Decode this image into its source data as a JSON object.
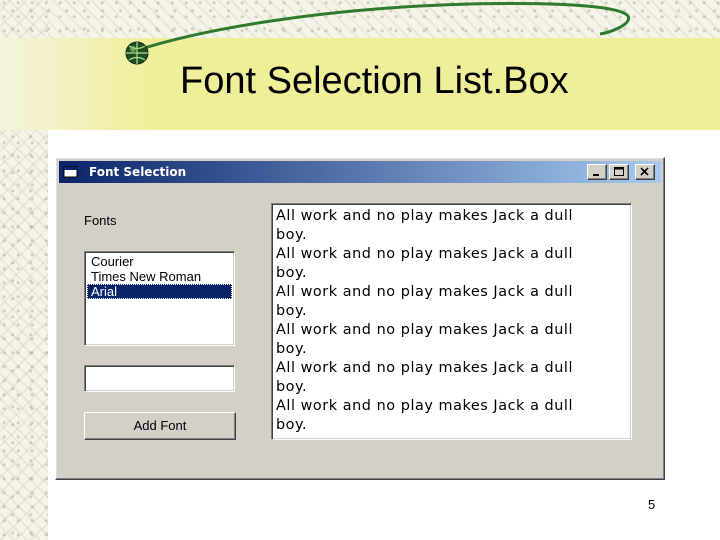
{
  "slide": {
    "title": "Font Selection List.Box",
    "page_number": "5"
  },
  "window": {
    "title": "Font Selection",
    "fonts_label": "Fonts",
    "font_list": [
      {
        "label": "Courier",
        "selected": false
      },
      {
        "label": "Times New Roman",
        "selected": false
      },
      {
        "label": "Arial",
        "selected": true
      }
    ],
    "font_input_value": "",
    "add_font_label": "Add Font",
    "text_lines": [
      "All work and no play makes Jack a dull",
      "boy.",
      "All work and no play makes Jack a dull",
      "boy.",
      "All work and no play makes Jack a dull",
      "boy.",
      "All work and no play makes Jack a dull",
      "boy.",
      "All work and no play makes Jack a dull",
      "boy.",
      "All work and no play makes Jack a dull",
      "boy."
    ]
  },
  "colors": {
    "title_band": "#efef9a",
    "window_titlebar_start": "#0a246a",
    "window_titlebar_end": "#a6caf0",
    "window_face": "#d4d0c8",
    "selection": "#0a246a",
    "deco_green": "#2f7a2f"
  },
  "icons": {
    "slide_bullet": "globe-icon",
    "window_icon": "app-window-icon",
    "minimize": "minimize-icon",
    "maximize": "maximize-icon",
    "close": "close-icon"
  }
}
